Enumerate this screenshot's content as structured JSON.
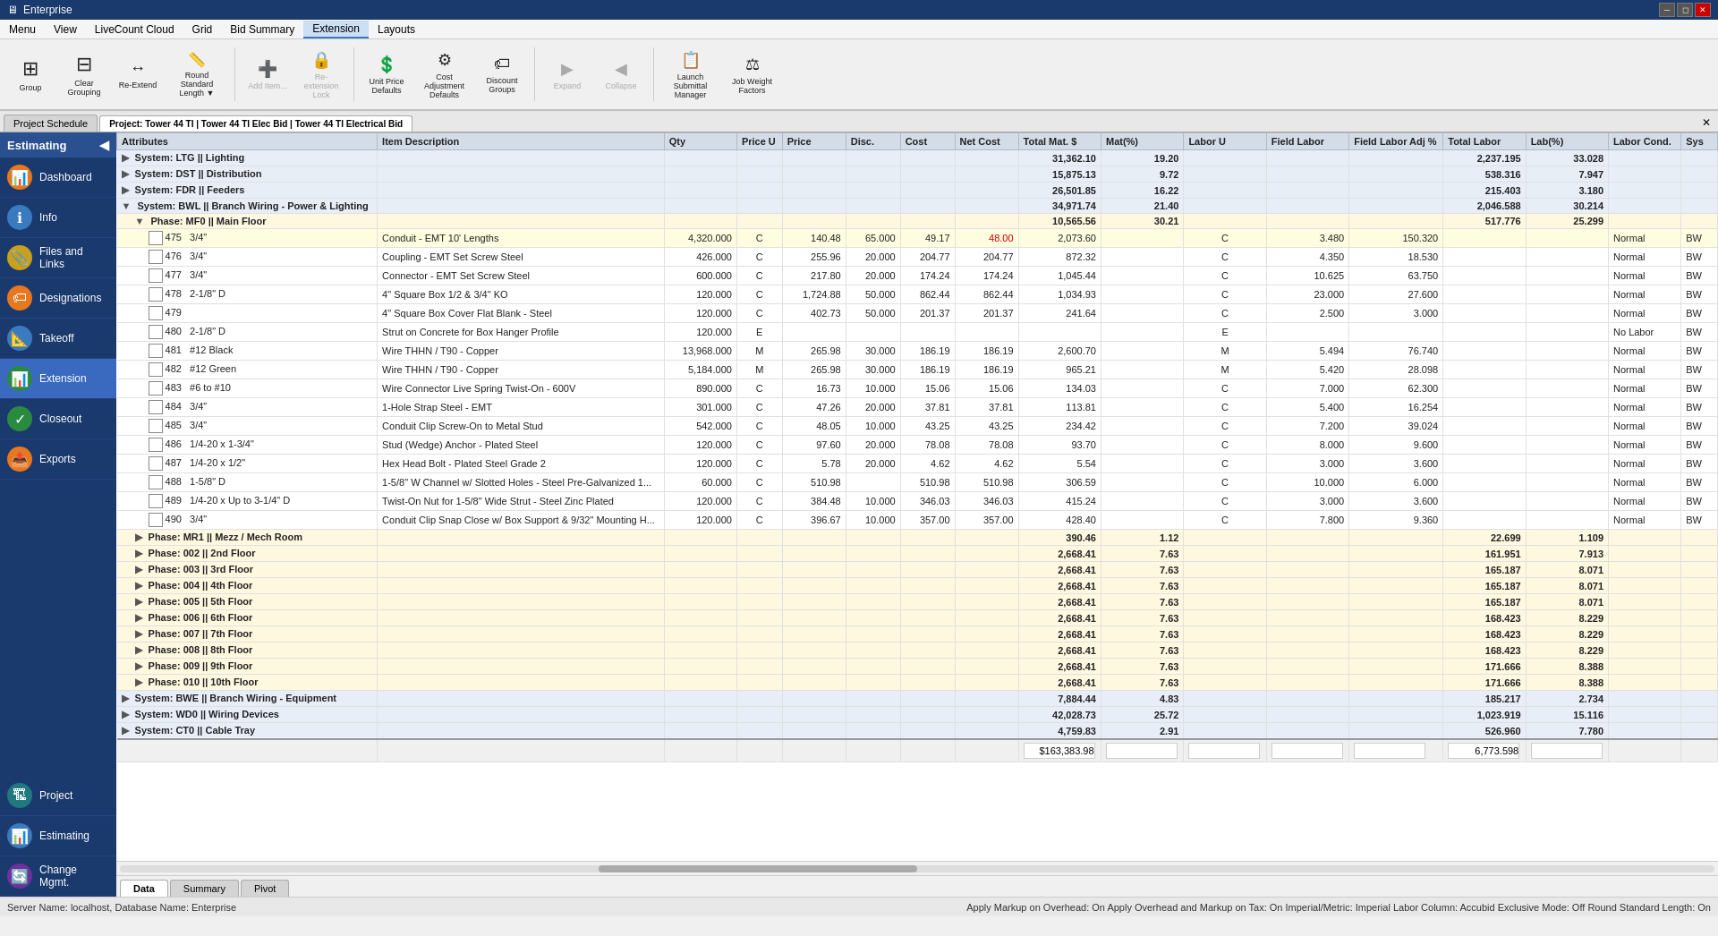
{
  "app": {
    "title": "Enterprise",
    "window_controls": [
      "minimize",
      "restore",
      "close"
    ]
  },
  "menubar": {
    "items": [
      "Menu",
      "View",
      "LiveCount Cloud",
      "Grid",
      "Bid Summary",
      "Extension",
      "Layouts"
    ]
  },
  "toolbar": {
    "buttons": [
      {
        "id": "group",
        "label": "Group",
        "icon": "⊞",
        "disabled": false
      },
      {
        "id": "clear-grouping",
        "label": "Clear Grouping",
        "icon": "⊟",
        "disabled": false
      },
      {
        "id": "re-extend",
        "label": "Re-Extend",
        "icon": "↔",
        "disabled": false
      },
      {
        "id": "round-standard-length",
        "label": "Round Standard Length ▼",
        "icon": "📏",
        "disabled": false
      },
      {
        "id": "add-item",
        "label": "Add Item...",
        "icon": "➕",
        "disabled": true
      },
      {
        "id": "re-extension-lock",
        "label": "Re-extension Lock",
        "icon": "🔒",
        "disabled": true
      },
      {
        "id": "unit-price-defaults",
        "label": "Unit Price Defaults",
        "icon": "💲",
        "disabled": false
      },
      {
        "id": "cost-adjustment-defaults",
        "label": "Cost Adjustment Defaults",
        "icon": "⚙",
        "disabled": false
      },
      {
        "id": "discount-groups",
        "label": "Discount Groups",
        "icon": "🏷",
        "disabled": false
      },
      {
        "id": "expand",
        "label": "Expand",
        "icon": "▶",
        "disabled": true
      },
      {
        "id": "collapse",
        "label": "Collapse",
        "icon": "◀",
        "disabled": true
      },
      {
        "id": "launch-submittal-manager",
        "label": "Launch Submittal Manager",
        "icon": "📋",
        "disabled": false
      },
      {
        "id": "job-weight-factors",
        "label": "Job Weight Factors",
        "icon": "⚖",
        "disabled": false
      }
    ]
  },
  "tabs": {
    "project_schedule": "Project Schedule",
    "project_tab": "Project: Tower 44 TI | Tower 44 TI Elec Bid | Tower 44 TI Electrical Bid"
  },
  "sidebar": {
    "header": "Estimating",
    "items": [
      {
        "id": "dashboard",
        "label": "Dashboard",
        "icon": "📊",
        "color": "orange"
      },
      {
        "id": "info",
        "label": "Info",
        "icon": "ℹ",
        "color": "blue"
      },
      {
        "id": "files-links",
        "label": "Files and Links",
        "icon": "📎",
        "color": "yellow"
      },
      {
        "id": "designations",
        "label": "Designations",
        "icon": "🏷",
        "color": "orange"
      },
      {
        "id": "takeoff",
        "label": "Takeoff",
        "icon": "📐",
        "color": "blue"
      },
      {
        "id": "extension",
        "label": "Extension",
        "icon": "📊",
        "color": "green",
        "active": true
      },
      {
        "id": "closeout",
        "label": "Closeout",
        "icon": "✓",
        "color": "green"
      },
      {
        "id": "exports",
        "label": "Exports",
        "icon": "📤",
        "color": "orange"
      }
    ],
    "bottom_items": [
      {
        "id": "project",
        "label": "Project",
        "icon": "🏗",
        "color": "teal"
      },
      {
        "id": "estimating-bottom",
        "label": "Estimating",
        "icon": "📊",
        "color": "blue"
      },
      {
        "id": "change-mgmt",
        "label": "Change Mgmt.",
        "icon": "🔄",
        "color": "purple"
      }
    ]
  },
  "table": {
    "columns": [
      "Attributes",
      "Item Description",
      "Qty",
      "Price U",
      "Price",
      "Disc.",
      "Cost",
      "Net Cost",
      "Total Mat. $",
      "Mat(%)",
      "Labor U",
      "Field Labor",
      "Field Labor Adj %",
      "Total Labor",
      "Lab(%)",
      "Labor Cond.",
      "Sys"
    ],
    "rows": [
      {
        "type": "system",
        "indent": 0,
        "label": "System: LTG || Lighting",
        "total_mat": "31,362.10",
        "mat_pct": "19.20",
        "total_labor": "2,237.195",
        "lab_pct": "33.028"
      },
      {
        "type": "system",
        "indent": 0,
        "label": "System: DST || Distribution",
        "total_mat": "15,875.13",
        "mat_pct": "9.72",
        "total_labor": "538.316",
        "lab_pct": "7.947"
      },
      {
        "type": "system",
        "indent": 0,
        "label": "System: FDR || Feeders",
        "total_mat": "26,501.85",
        "mat_pct": "16.22",
        "total_labor": "215.403",
        "lab_pct": "3.180"
      },
      {
        "type": "system",
        "indent": 0,
        "label": "System: BWL || Branch Wiring - Power & Lighting",
        "total_mat": "34,971.74",
        "mat_pct": "21.40",
        "total_labor": "2,046.588",
        "lab_pct": "30.214"
      },
      {
        "type": "phase",
        "indent": 1,
        "label": "Phase: MF0 || Main Floor",
        "total_mat": "10,565.56",
        "mat_pct": "30.21",
        "total_labor": "517.776",
        "lab_pct": "25.299"
      },
      {
        "type": "item",
        "row_num": "475",
        "col2": "3/4\"",
        "desc": "Conduit - EMT 10' Lengths",
        "qty": "4,320.000",
        "price_u": "C",
        "price": "140.48",
        "disc": "65.000",
        "cost": "49.17",
        "net_cost": "48.00",
        "total_mat": "2,073.60",
        "mat_flag": "C",
        "labor_u": "3.480",
        "field_labor": "150.320",
        "total_labor": "",
        "lab_flag": "Normal",
        "sys": "BW"
      },
      {
        "type": "item",
        "row_num": "476",
        "col2": "3/4\"",
        "desc": "Coupling - EMT Set Screw Steel",
        "qty": "426.000",
        "price_u": "C",
        "price": "255.96",
        "disc": "20.000",
        "cost": "204.77",
        "net_cost": "204.77",
        "total_mat": "872.32",
        "mat_flag": "C",
        "labor_u": "4.350",
        "field_labor": "18.530",
        "total_labor": "",
        "lab_flag": "Normal",
        "sys": "BW"
      },
      {
        "type": "item",
        "row_num": "477",
        "col2": "3/4\"",
        "desc": "Connector - EMT Set Screw Steel",
        "qty": "600.000",
        "price_u": "C",
        "price": "217.80",
        "disc": "20.000",
        "cost": "174.24",
        "net_cost": "174.24",
        "total_mat": "1,045.44",
        "mat_flag": "C",
        "labor_u": "10.625",
        "field_labor": "63.750",
        "total_labor": "",
        "lab_flag": "Normal",
        "sys": "BW"
      },
      {
        "type": "item",
        "row_num": "478",
        "col2": "2-1/8\" D",
        "desc": "4\" Square Box 1/2 & 3/4\" KO",
        "qty": "120.000",
        "price_u": "C",
        "price": "1,724.88",
        "disc": "50.000",
        "cost": "862.44",
        "net_cost": "862.44",
        "total_mat": "1,034.93",
        "mat_flag": "C",
        "labor_u": "23.000",
        "field_labor": "27.600",
        "total_labor": "",
        "lab_flag": "Normal",
        "sys": "BW"
      },
      {
        "type": "item",
        "row_num": "479",
        "col2": "",
        "desc": "4\" Square Box Cover Flat Blank - Steel",
        "qty": "120.000",
        "price_u": "C",
        "price": "402.73",
        "disc": "50.000",
        "cost": "201.37",
        "net_cost": "201.37",
        "total_mat": "241.64",
        "mat_flag": "C",
        "labor_u": "2.500",
        "field_labor": "3.000",
        "total_labor": "",
        "lab_flag": "Normal",
        "sys": "BW"
      },
      {
        "type": "item",
        "row_num": "480",
        "col2": "2-1/8\" D",
        "desc": "Strut on Concrete for Box Hanger Profile",
        "qty": "120.000",
        "price_u": "E",
        "price": "",
        "disc": "",
        "cost": "",
        "net_cost": "",
        "total_mat": "",
        "mat_flag": "E",
        "labor_u": "",
        "field_labor": "",
        "total_labor": "",
        "lab_flag": "No Labor",
        "sys": "BW"
      },
      {
        "type": "item",
        "row_num": "481",
        "col2": "#12 Black",
        "desc": "Wire THHN / T90 - Copper",
        "qty": "13,968.000",
        "price_u": "M",
        "price": "265.98",
        "disc": "30.000",
        "cost": "186.19",
        "net_cost": "186.19",
        "total_mat": "2,600.70",
        "mat_flag": "M",
        "labor_u": "5.494",
        "field_labor": "76.740",
        "total_labor": "",
        "lab_flag": "Normal",
        "sys": "BW"
      },
      {
        "type": "item",
        "row_num": "482",
        "col2": "#12 Green",
        "desc": "Wire THHN / T90 - Copper",
        "qty": "5,184.000",
        "price_u": "M",
        "price": "265.98",
        "disc": "30.000",
        "cost": "186.19",
        "net_cost": "186.19",
        "total_mat": "965.21",
        "mat_flag": "M",
        "labor_u": "5.420",
        "field_labor": "28.098",
        "total_labor": "",
        "lab_flag": "Normal",
        "sys": "BW"
      },
      {
        "type": "item",
        "row_num": "483",
        "col2": "#6 to #10",
        "desc": "Wire Connector Live Spring Twist-On - 600V",
        "qty": "890.000",
        "price_u": "C",
        "price": "16.73",
        "disc": "10.000",
        "cost": "15.06",
        "net_cost": "15.06",
        "total_mat": "134.03",
        "mat_flag": "C",
        "labor_u": "7.000",
        "field_labor": "62.300",
        "total_labor": "",
        "lab_flag": "Normal",
        "sys": "BW"
      },
      {
        "type": "item",
        "row_num": "484",
        "col2": "3/4\"",
        "desc": "1-Hole Strap Steel - EMT",
        "qty": "301.000",
        "price_u": "C",
        "price": "47.26",
        "disc": "20.000",
        "cost": "37.81",
        "net_cost": "37.81",
        "total_mat": "113.81",
        "mat_flag": "C",
        "labor_u": "5.400",
        "field_labor": "16.254",
        "total_labor": "",
        "lab_flag": "Normal",
        "sys": "BW"
      },
      {
        "type": "item",
        "row_num": "485",
        "col2": "3/4\"",
        "desc": "Conduit Clip Screw-On to Metal Stud",
        "qty": "542.000",
        "price_u": "C",
        "price": "48.05",
        "disc": "10.000",
        "cost": "43.25",
        "net_cost": "43.25",
        "total_mat": "234.42",
        "mat_flag": "C",
        "labor_u": "7.200",
        "field_labor": "39.024",
        "total_labor": "",
        "lab_flag": "Normal",
        "sys": "BW"
      },
      {
        "type": "item",
        "row_num": "486",
        "col2": "1/4-20 x 1-3/4\"",
        "desc": "Stud (Wedge) Anchor - Plated Steel",
        "qty": "120.000",
        "price_u": "C",
        "price": "97.60",
        "disc": "20.000",
        "cost": "78.08",
        "net_cost": "78.08",
        "total_mat": "93.70",
        "mat_flag": "C",
        "labor_u": "8.000",
        "field_labor": "9.600",
        "total_labor": "",
        "lab_flag": "Normal",
        "sys": "BW"
      },
      {
        "type": "item",
        "row_num": "487",
        "col2": "1/4-20 x 1/2\"",
        "desc": "Hex Head Bolt - Plated Steel Grade 2",
        "qty": "120.000",
        "price_u": "C",
        "price": "5.78",
        "disc": "20.000",
        "cost": "4.62",
        "net_cost": "4.62",
        "total_mat": "5.54",
        "mat_flag": "C",
        "labor_u": "3.000",
        "field_labor": "3.600",
        "total_labor": "",
        "lab_flag": "Normal",
        "sys": "BW"
      },
      {
        "type": "item",
        "row_num": "488",
        "col2": "1-5/8\" D",
        "desc": "1-5/8\" W Channel w/ Slotted Holes - Steel Pre-Galvanized 1...",
        "qty": "60.000",
        "price_u": "C",
        "price": "510.98",
        "disc": "",
        "cost": "510.98",
        "net_cost": "510.98",
        "total_mat": "306.59",
        "mat_flag": "C",
        "labor_u": "10.000",
        "field_labor": "6.000",
        "total_labor": "",
        "lab_flag": "Normal",
        "sys": "BW"
      },
      {
        "type": "item",
        "row_num": "489",
        "col2": "1/4-20 x Up to 3-1/4\" D",
        "desc": "Twist-On Nut for 1-5/8\" Wide Strut - Steel Zinc Plated",
        "qty": "120.000",
        "price_u": "C",
        "price": "384.48",
        "disc": "10.000",
        "cost": "346.03",
        "net_cost": "346.03",
        "total_mat": "415.24",
        "mat_flag": "C",
        "labor_u": "3.000",
        "field_labor": "3.600",
        "total_labor": "",
        "lab_flag": "Normal",
        "sys": "BW"
      },
      {
        "type": "item",
        "row_num": "490",
        "col2": "3/4\"",
        "desc": "Conduit Clip Snap Close w/ Box Support & 9/32\" Mounting H...",
        "qty": "120.000",
        "price_u": "C",
        "price": "396.67",
        "disc": "10.000",
        "cost": "357.00",
        "net_cost": "357.00",
        "total_mat": "428.40",
        "mat_flag": "C",
        "labor_u": "7.800",
        "field_labor": "9.360",
        "total_labor": "",
        "lab_flag": "Normal",
        "sys": "BW"
      },
      {
        "type": "phase",
        "indent": 1,
        "label": "Phase: MR1 || Mezz / Mech Room",
        "total_mat": "390.46",
        "mat_pct": "1.12",
        "total_labor": "22.699",
        "lab_pct": "1.109"
      },
      {
        "type": "phase",
        "indent": 1,
        "label": "Phase: 002 || 2nd Floor",
        "total_mat": "2,668.41",
        "mat_pct": "7.63",
        "total_labor": "161.951",
        "lab_pct": "7.913"
      },
      {
        "type": "phase",
        "indent": 1,
        "label": "Phase: 003 || 3rd Floor",
        "total_mat": "2,668.41",
        "mat_pct": "7.63",
        "total_labor": "165.187",
        "lab_pct": "8.071"
      },
      {
        "type": "phase",
        "indent": 1,
        "label": "Phase: 004 || 4th Floor",
        "total_mat": "2,668.41",
        "mat_pct": "7.63",
        "total_labor": "165.187",
        "lab_pct": "8.071"
      },
      {
        "type": "phase",
        "indent": 1,
        "label": "Phase: 005 || 5th Floor",
        "total_mat": "2,668.41",
        "mat_pct": "7.63",
        "total_labor": "165.187",
        "lab_pct": "8.071"
      },
      {
        "type": "phase",
        "indent": 1,
        "label": "Phase: 006 || 6th Floor",
        "total_mat": "2,668.41",
        "mat_pct": "7.63",
        "total_labor": "168.423",
        "lab_pct": "8.229"
      },
      {
        "type": "phase",
        "indent": 1,
        "label": "Phase: 007 || 7th Floor",
        "total_mat": "2,668.41",
        "mat_pct": "7.63",
        "total_labor": "168.423",
        "lab_pct": "8.229"
      },
      {
        "type": "phase",
        "indent": 1,
        "label": "Phase: 008 || 8th Floor",
        "total_mat": "2,668.41",
        "mat_pct": "7.63",
        "total_labor": "168.423",
        "lab_pct": "8.229"
      },
      {
        "type": "phase",
        "indent": 1,
        "label": "Phase: 009 || 9th Floor",
        "total_mat": "2,668.41",
        "mat_pct": "7.63",
        "total_labor": "171.666",
        "lab_pct": "8.388"
      },
      {
        "type": "phase",
        "indent": 1,
        "label": "Phase: 010 || 10th Floor",
        "total_mat": "2,668.41",
        "mat_pct": "7.63",
        "total_labor": "171.666",
        "lab_pct": "8.388"
      },
      {
        "type": "system",
        "indent": 0,
        "label": "System: BWE || Branch Wiring - Equipment",
        "total_mat": "7,884.44",
        "mat_pct": "4.83",
        "total_labor": "185.217",
        "lab_pct": "2.734"
      },
      {
        "type": "system",
        "indent": 0,
        "label": "System: WD0 || Wiring Devices",
        "total_mat": "42,028.73",
        "mat_pct": "25.72",
        "total_labor": "1,023.919",
        "lab_pct": "15.116"
      },
      {
        "type": "system",
        "indent": 0,
        "label": "System: CT0 || Cable Tray",
        "total_mat": "4,759.83",
        "mat_pct": "2.91",
        "total_labor": "526.960",
        "lab_pct": "7.780"
      }
    ],
    "totals": {
      "total_mat": "$163,383.98",
      "total_labor": "6,773.598"
    }
  },
  "bottom_tabs": [
    "Data",
    "Summary",
    "Pivot"
  ],
  "statusbar": {
    "left": "Server Name: localhost, Database Name: Enterprise",
    "right": "Apply Markup on Overhead: On    Apply Overhead and Markup on Tax: On    Imperial/Metric: Imperial    Labor Column: Accubid    Exclusive Mode: Off    Round Standard Length: On"
  }
}
